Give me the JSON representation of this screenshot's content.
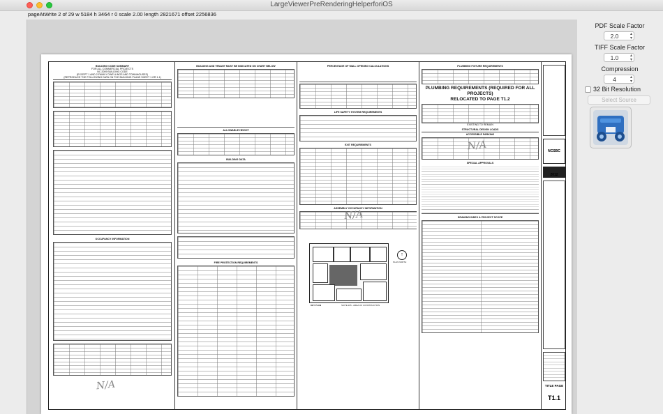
{
  "window": {
    "title": "LargeViewerPreRenderingHelperforiOS",
    "info": "pageAtWrite 2 of 29 w 5184 h 3464 r 0 scale 2.00 length 2821671 offset 2256836"
  },
  "sidebar": {
    "pdf_scale_label": "PDF Scale Factor",
    "pdf_scale_value": "2.0",
    "tiff_scale_label": "TIFF Scale Factor",
    "tiff_scale_value": "1.0",
    "compression_label": "Compression",
    "compression_value": "4",
    "bit32_label": "32 Bit Resolution",
    "select_source_label": "Select Source",
    "app_icon": "blue-printer-app-icon"
  },
  "document": {
    "col1_title": "BUILDING CODE SUMMARY",
    "col1_sub1": "FOR ALL COMMERCIAL PROJECTS",
    "col1_sub2": "NC 2009 BUILDING CODE",
    "col1_sub3": "(EXCEPT 1 AND 2-FAMILY DWELLINGS AND TOWNHOUSES)",
    "col1_sub4": "(REPRODUCE THE FOLLOWING DATA ON THE BUILDING PLANS SHEET 1 OR 1.1)",
    "col1_occupancy": "OCCUPANCY INFORMATION",
    "col2_title": "BUILDING AND TENANT MUST BE INDICATED ON CHART BELOW",
    "col2_allowable": "ALLOWABLE HEIGHT",
    "col2_building_data": "BUILDING DATA",
    "col2_fire_protection": "FIRE PROTECTION REQUIREMENTS",
    "col3_title": "PERCENTAGE OF WALL OPENING CALCULATIONS",
    "col3_life_safety": "LIFE SAFETY SYSTEM REQUIREMENTS",
    "col3_exit": "EXIT REQUIREMENTS",
    "col3_assembly": "ASSEMBLY OCCUPANCY INFORMATION",
    "col3_plan_north": "PLAN NORTH",
    "col3_key_plan": "KEY PLAN",
    "col3_suite": "SUITE 205 - AREA OF CONSTRUCTION",
    "col4_title": "PLUMBING FIXTURE REQUIREMENTS",
    "col4_callout_1": "PLUMBING REQUIREMENTS (REQUIRED FOR ALL PROJECTS)",
    "col4_callout_2": "RELOCATED TO PAGE T1.2",
    "col4_existing": "EXISTING TO REMAIN",
    "col4_structural": "STRUCTURAL DESIGN LOADS",
    "col4_accessible": "ACCESSIBLE PARKING",
    "col4_special": "SPECIAL APPROVALS",
    "col4_drawing_index": "DRAWING INDEX & PROJECT SCOPE",
    "na_text": "N/A",
    "title_block_code": "NCSBC 2012",
    "title_block_sheet": "T1.1",
    "title_block_label": "TITLE PAGE"
  }
}
